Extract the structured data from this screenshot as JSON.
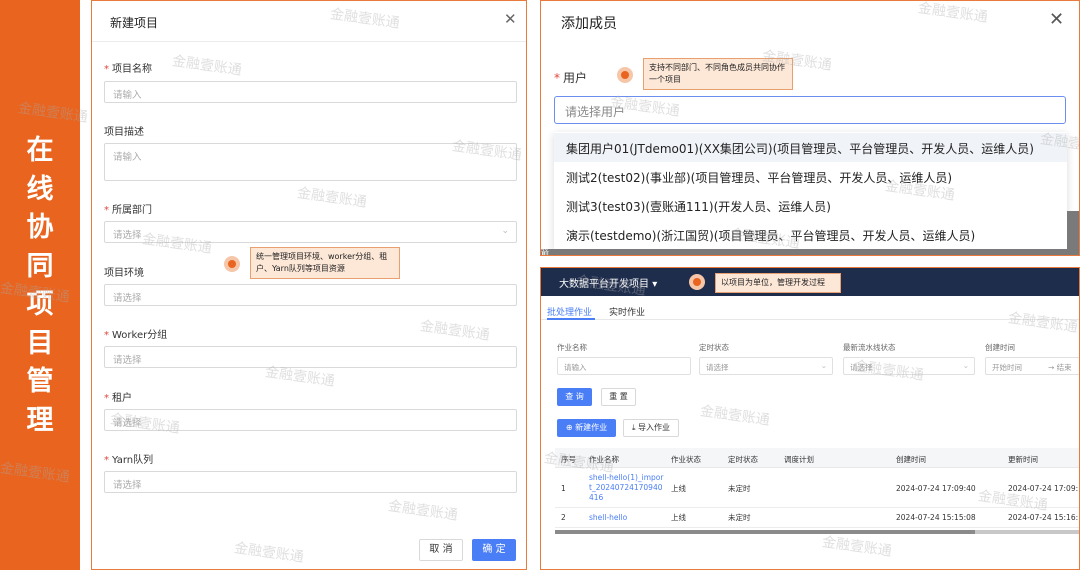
{
  "side": {
    "title": "在线协同项目管理",
    "watermark": "金融壹账通"
  },
  "new_project": {
    "title": "新建项目",
    "close_icon": "close-icon",
    "fields": [
      {
        "label": "项目名称",
        "required": true,
        "placeholder": "请输入"
      },
      {
        "label": "项目描述",
        "required": false,
        "placeholder": "请输入"
      },
      {
        "label": "所属部门",
        "required": true,
        "placeholder": "请选择"
      },
      {
        "label": "项目环境",
        "required": false,
        "placeholder": "请选择"
      },
      {
        "label": "Worker分组",
        "required": true,
        "placeholder": "请选择"
      },
      {
        "label": "租户",
        "required": true,
        "placeholder": "请选择"
      },
      {
        "label": "Yarn队列",
        "required": true,
        "placeholder": "请选择"
      }
    ],
    "callout": "统一管理项目环境、worker分组、租户、Yarn队列等项目资源",
    "cancel_label": "取 消",
    "ok_label": "确 定"
  },
  "add_member": {
    "title": "添加成员",
    "user_label": "用户",
    "placeholder": "请选择用户",
    "callout": "支持不同部门、不同角色成员共同协作一个项目",
    "options": [
      "集团用户01(JTdemo01)(XX集团公司)(项目管理员、平台管理员、开发人员、运维人员)",
      "测试2(test02)(事业部)(项目管理员、平台管理员、开发人员、运维人员)",
      "测试3(test03)(壹账通111)(开发人员、运维人员)",
      "演示(testdemo)(浙江国贸)(项目管理员、平台管理员、开发人员、运维人员)"
    ],
    "cut_text": "箭"
  },
  "job_panel": {
    "project_name": "大数据平台开发项目",
    "callout": "以项目为单位，管理开发过程",
    "tabs": [
      "批处理作业",
      "实时作业"
    ],
    "filters": [
      {
        "label": "作业名称",
        "placeholder": "请输入"
      },
      {
        "label": "定时状态",
        "placeholder": "请选择"
      },
      {
        "label": "最新流水线状态",
        "placeholder": "请选择"
      },
      {
        "label": "创建时间",
        "placeholder": "开始时间",
        "end": "结束"
      }
    ],
    "query_label": "查 询",
    "reset_label": "重 置",
    "new_job_label": "新建作业",
    "import_job_label": "导入作业",
    "columns": [
      "序号",
      "作业名称",
      "作业状态",
      "定时状态",
      "调度计划",
      "创建时间",
      "更新时间"
    ],
    "rows": [
      {
        "no": "1",
        "name": "shell-hello(1)_import_20240724170940416",
        "status": "上线",
        "timer": "未定时",
        "plan": "",
        "created": "2024-07-24 17:09:40",
        "updated": "2024-07-24 17:09:"
      },
      {
        "no": "2",
        "name": "shell-hello",
        "status": "上线",
        "timer": "未定时",
        "plan": "",
        "created": "2024-07-24 15:15:08",
        "updated": "2024-07-24 15:16:"
      }
    ]
  }
}
